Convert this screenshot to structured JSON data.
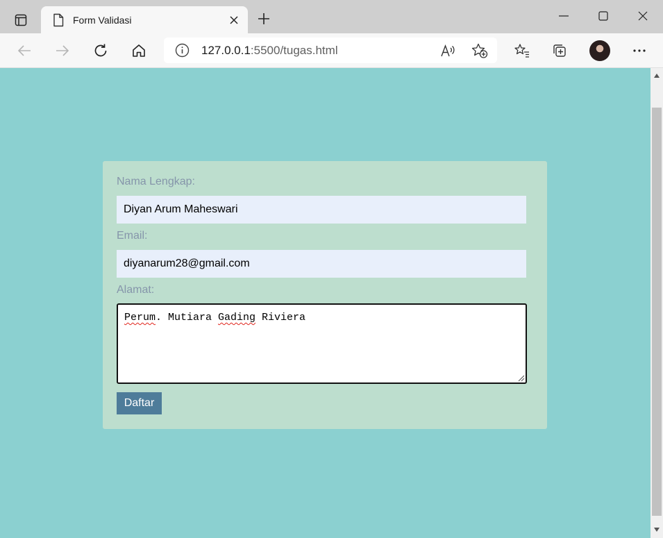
{
  "tab": {
    "title": "Form Validasi"
  },
  "address": {
    "host": "127.0.0.1",
    "rest": ":5500/tugas.html"
  },
  "form": {
    "name_label": "Nama Lengkap:",
    "name_value": "Diyan Arum Maheswari",
    "email_label": "Email:",
    "email_value": "diyanarum28@gmail.com",
    "address_label": "Alamat:",
    "address_words": [
      "Perum",
      ". Mutiara ",
      "Gading",
      " Riviera"
    ],
    "submit_label": "Daftar"
  },
  "colors": {
    "page_bg": "#8bd0d0",
    "card_bg": "#bddece",
    "label": "#8595aa",
    "input_bg": "#e8effb",
    "button_bg": "#4e7c9a"
  },
  "icons": {
    "tab_actions": "tab-actions-icon",
    "tab_page": "document-icon",
    "tab_close": "close-icon",
    "new_tab": "plus-icon",
    "minimize": "minimize-icon",
    "maximize": "maximize-icon",
    "close_window": "close-icon",
    "back": "arrow-left-icon",
    "forward": "arrow-right-icon",
    "refresh": "refresh-icon",
    "home": "home-icon",
    "site_info": "info-icon",
    "read_aloud": "read-aloud-icon",
    "add_favorite": "star-plus-icon",
    "favorites": "favorites-icon",
    "collections": "collections-icon",
    "profile": "avatar",
    "menu": "more-icon"
  }
}
